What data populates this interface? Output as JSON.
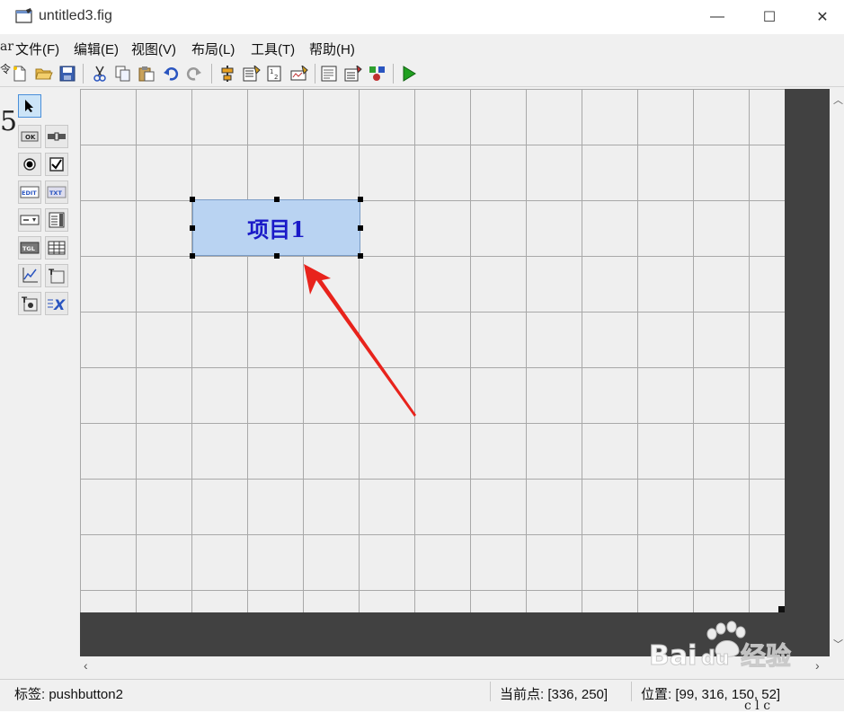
{
  "window": {
    "title": "untitled3.fig",
    "minimize_symbol": "—",
    "maximize_symbol": "☐",
    "close_symbol": "✕"
  },
  "menu": [
    {
      "label": "文件(F)"
    },
    {
      "label": "编辑(E)"
    },
    {
      "label": "视图(V)"
    },
    {
      "label": "布局(L)"
    },
    {
      "label": "工具(T)"
    },
    {
      "label": "帮助(H)"
    }
  ],
  "toolbar": {
    "icons": [
      "new-file-icon",
      "open-folder-icon",
      "save-icon",
      "cut-icon",
      "copy-icon",
      "paste-icon",
      "undo-icon",
      "redo-icon",
      "align-icon",
      "menu-editor-icon",
      "tab-order-icon",
      "toolbar-editor-icon",
      "editor-icon",
      "property-inspector-icon",
      "object-browser-icon",
      "run-icon"
    ]
  },
  "palette": {
    "tools": [
      {
        "name": "select-tool",
        "label": ""
      },
      {
        "name": "pushbutton-tool",
        "label": "OK"
      },
      {
        "name": "slider-tool",
        "label": ""
      },
      {
        "name": "radio-button-tool",
        "label": ""
      },
      {
        "name": "checkbox-tool",
        "label": ""
      },
      {
        "name": "edit-text-tool",
        "label": "EDIT"
      },
      {
        "name": "static-text-tool",
        "label": "TXT"
      },
      {
        "name": "popup-menu-tool",
        "label": ""
      },
      {
        "name": "listbox-tool",
        "label": ""
      },
      {
        "name": "toggle-button-tool",
        "label": "TGL"
      },
      {
        "name": "table-tool",
        "label": ""
      },
      {
        "name": "axes-tool",
        "label": ""
      },
      {
        "name": "panel-tool",
        "label": "T"
      },
      {
        "name": "button-group-tool",
        "label": "T"
      },
      {
        "name": "activex-tool",
        "label": "X"
      }
    ]
  },
  "canvas": {
    "selected_button_label": "项目1"
  },
  "status": {
    "tag": "标签: pushbutton2",
    "current_point": "当前点:  [336, 250]",
    "position": "位置: [99, 316, 150, 52]"
  },
  "background_fragments": {
    "left_top": "ar",
    "left_mid": "令",
    "left_big": "5",
    "bottom_right": "c l c"
  },
  "watermark": {
    "text1": "Bai",
    "text2": "du",
    "text3": "经验"
  },
  "colors": {
    "button_fill": "#b9d3f2",
    "button_text": "#1a1ac8",
    "arrow": "#e8231c",
    "dark_border": "#414141"
  }
}
